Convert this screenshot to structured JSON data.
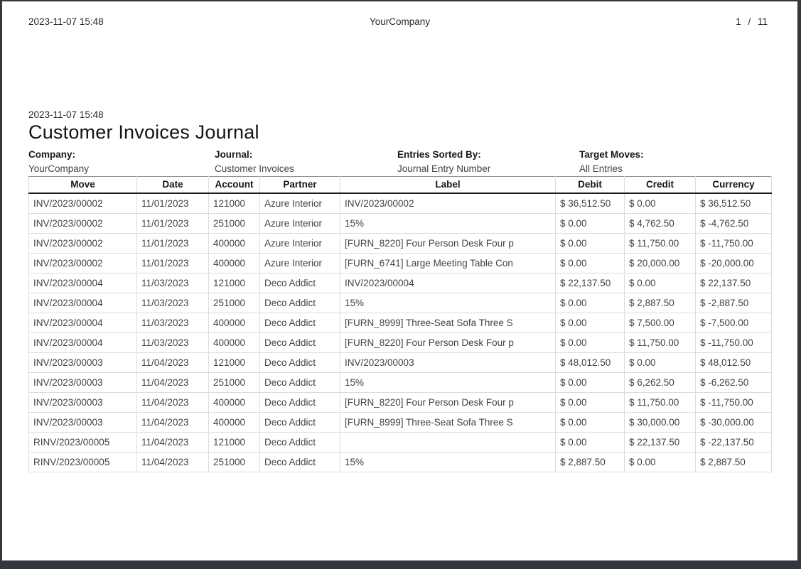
{
  "page_header": {
    "datetime": "2023-11-07 15:48",
    "company": "YourCompany",
    "page_indicator": "1 / 11"
  },
  "report": {
    "datetime": "2023-11-07 15:48",
    "title": "Customer Invoices Journal",
    "meta": [
      {
        "label": "Company:",
        "value": "YourCompany"
      },
      {
        "label": "Journal:",
        "value": "Customer Invoices"
      },
      {
        "label": "Entries Sorted By:",
        "value": "Journal Entry Number"
      },
      {
        "label": "Target Moves:",
        "value": "All Entries"
      }
    ]
  },
  "table": {
    "columns": [
      "Move",
      "Date",
      "Account",
      "Partner",
      "Label",
      "Debit",
      "Credit",
      "Currency"
    ],
    "rows": [
      [
        "INV/2023/00002",
        "11/01/2023",
        "121000",
        "Azure Interior",
        "INV/2023/00002",
        "$ 36,512.50",
        "$ 0.00",
        "$ 36,512.50"
      ],
      [
        "INV/2023/00002",
        "11/01/2023",
        "251000",
        "Azure Interior",
        "15%",
        "$ 0.00",
        "$ 4,762.50",
        "$ -4,762.50"
      ],
      [
        "INV/2023/00002",
        "11/01/2023",
        "400000",
        "Azure Interior",
        "[FURN_8220] Four Person Desk Four p",
        "$ 0.00",
        "$ 11,750.00",
        "$ -11,750.00"
      ],
      [
        "INV/2023/00002",
        "11/01/2023",
        "400000",
        "Azure Interior",
        "[FURN_6741] Large Meeting Table Con",
        "$ 0.00",
        "$ 20,000.00",
        "$ -20,000.00"
      ],
      [
        "INV/2023/00004",
        "11/03/2023",
        "121000",
        "Deco Addict",
        "INV/2023/00004",
        "$ 22,137.50",
        "$ 0.00",
        "$ 22,137.50"
      ],
      [
        "INV/2023/00004",
        "11/03/2023",
        "251000",
        "Deco Addict",
        "15%",
        "$ 0.00",
        "$ 2,887.50",
        "$ -2,887.50"
      ],
      [
        "INV/2023/00004",
        "11/03/2023",
        "400000",
        "Deco Addict",
        "[FURN_8999] Three-Seat Sofa Three S",
        "$ 0.00",
        "$ 7,500.00",
        "$ -7,500.00"
      ],
      [
        "INV/2023/00004",
        "11/03/2023",
        "400000",
        "Deco Addict",
        "[FURN_8220] Four Person Desk Four p",
        "$ 0.00",
        "$ 11,750.00",
        "$ -11,750.00"
      ],
      [
        "INV/2023/00003",
        "11/04/2023",
        "121000",
        "Deco Addict",
        "INV/2023/00003",
        "$ 48,012.50",
        "$ 0.00",
        "$ 48,012.50"
      ],
      [
        "INV/2023/00003",
        "11/04/2023",
        "251000",
        "Deco Addict",
        "15%",
        "$ 0.00",
        "$ 6,262.50",
        "$ -6,262.50"
      ],
      [
        "INV/2023/00003",
        "11/04/2023",
        "400000",
        "Deco Addict",
        "[FURN_8220] Four Person Desk Four p",
        "$ 0.00",
        "$ 11,750.00",
        "$ -11,750.00"
      ],
      [
        "INV/2023/00003",
        "11/04/2023",
        "400000",
        "Deco Addict",
        "[FURN_8999] Three-Seat Sofa Three S",
        "$ 0.00",
        "$ 30,000.00",
        "$ -30,000.00"
      ],
      [
        "RINV/2023/00005",
        "11/04/2023",
        "121000",
        "Deco Addict",
        "",
        "$ 0.00",
        "$ 22,137.50",
        "$ -22,137.50"
      ],
      [
        "RINV/2023/00005",
        "11/04/2023",
        "251000",
        "Deco Addict",
        "15%",
        "$ 2,887.50",
        "$ 0.00",
        "$ 2,887.50"
      ]
    ]
  },
  "colors": {
    "page_background": "#ffffff",
    "frame_background": "#34383d",
    "text": "#3d4349",
    "heading_text": "#14181c",
    "table_grid": "#dcdcdc",
    "header_rule": "#1a1d20"
  }
}
